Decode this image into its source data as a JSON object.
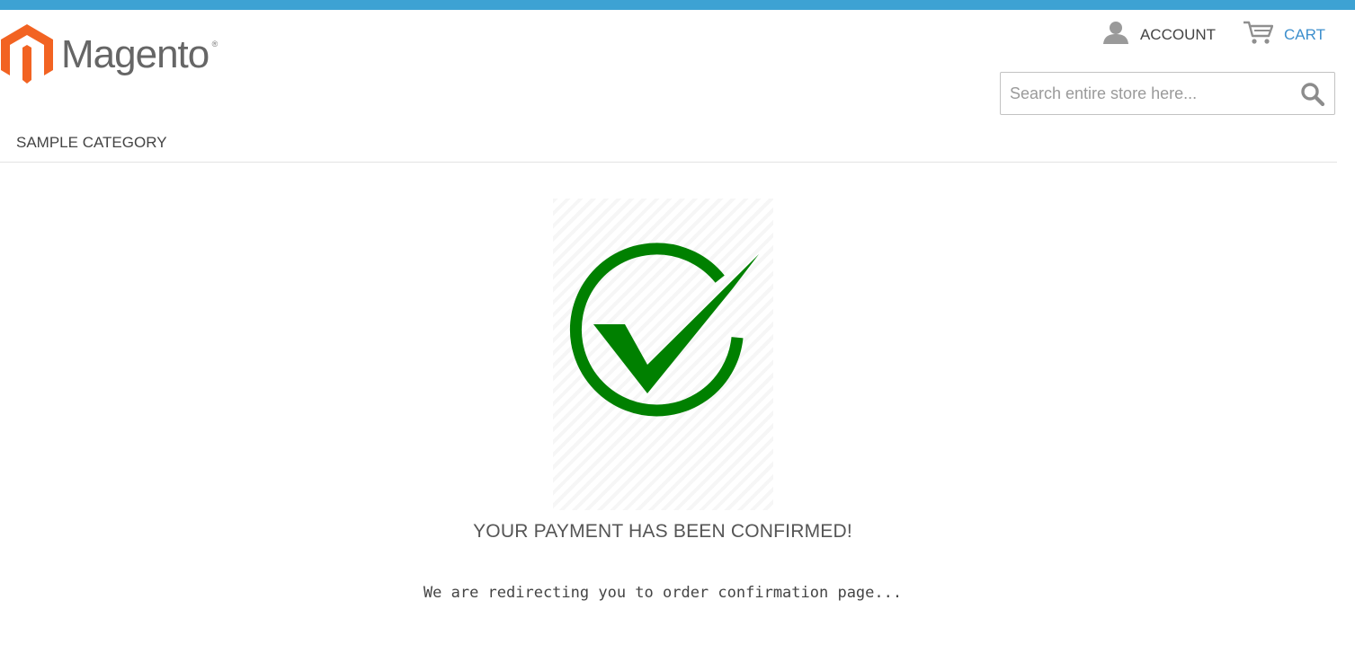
{
  "brand": {
    "logo_text": "Magento",
    "logo_registered": "®",
    "logo_icon": "magento-logo-icon",
    "brand_color": "#f26322",
    "accent_color": "#3da2d3"
  },
  "header": {
    "account_label": "ACCOUNT",
    "account_icon": "user-icon",
    "cart_label": "CART",
    "cart_icon": "cart-icon",
    "cart_color": "#3d8fcd"
  },
  "search": {
    "placeholder": "Search entire store here...",
    "value": "",
    "icon": "search-icon"
  },
  "nav": {
    "items": [
      {
        "label": "SAMPLE CATEGORY"
      }
    ]
  },
  "confirmation": {
    "icon": "check-circle-icon",
    "icon_color": "#008000",
    "title": "YOUR PAYMENT HAS BEEN CONFIRMED!",
    "message": "We are redirecting you to order confirmation page..."
  }
}
